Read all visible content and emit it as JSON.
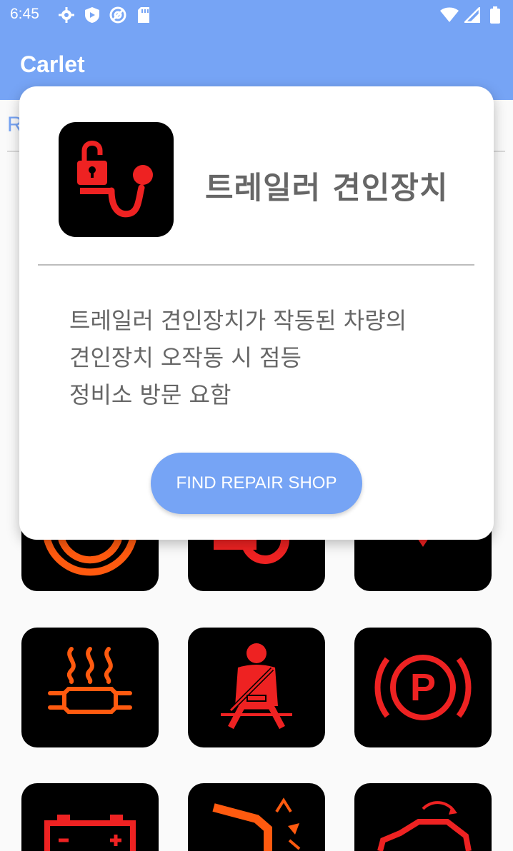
{
  "status_bar": {
    "time": "6:45",
    "left_icons": [
      "gear-icon",
      "shield-play-icon",
      "at-sign-icon",
      "sd-card-icon"
    ],
    "right_icons": [
      "wifi-icon",
      "signal-icon",
      "battery-icon"
    ]
  },
  "app_bar": {
    "title": "Carlet"
  },
  "background": {
    "tab_fragment": "R"
  },
  "dialog": {
    "icon": "trailer-hitch-lock-icon",
    "title": "트레일러 견인장치",
    "description_lines": [
      "트레일러 견인장치가 작동된 차량의",
      "견인장치 오작동 시 점등",
      "정비소 방문 요함"
    ],
    "button_label": "FIND REPAIR SHOP"
  },
  "colors": {
    "primary": "#76a4f5",
    "warning_red": "#ee2222",
    "warning_orange": "#ff5a0f",
    "tile_background": "#000000",
    "text_gray": "#666666"
  },
  "grid_icons": [
    "abs-warning-icon",
    "oil-temperature-icon",
    "airbag-warning-icon",
    "exhaust-heater-icon",
    "seatbelt-warning-icon",
    "parking-brake-icon",
    "battery-warning-icon",
    "oil-level-icon",
    "car-door-open-icon"
  ]
}
